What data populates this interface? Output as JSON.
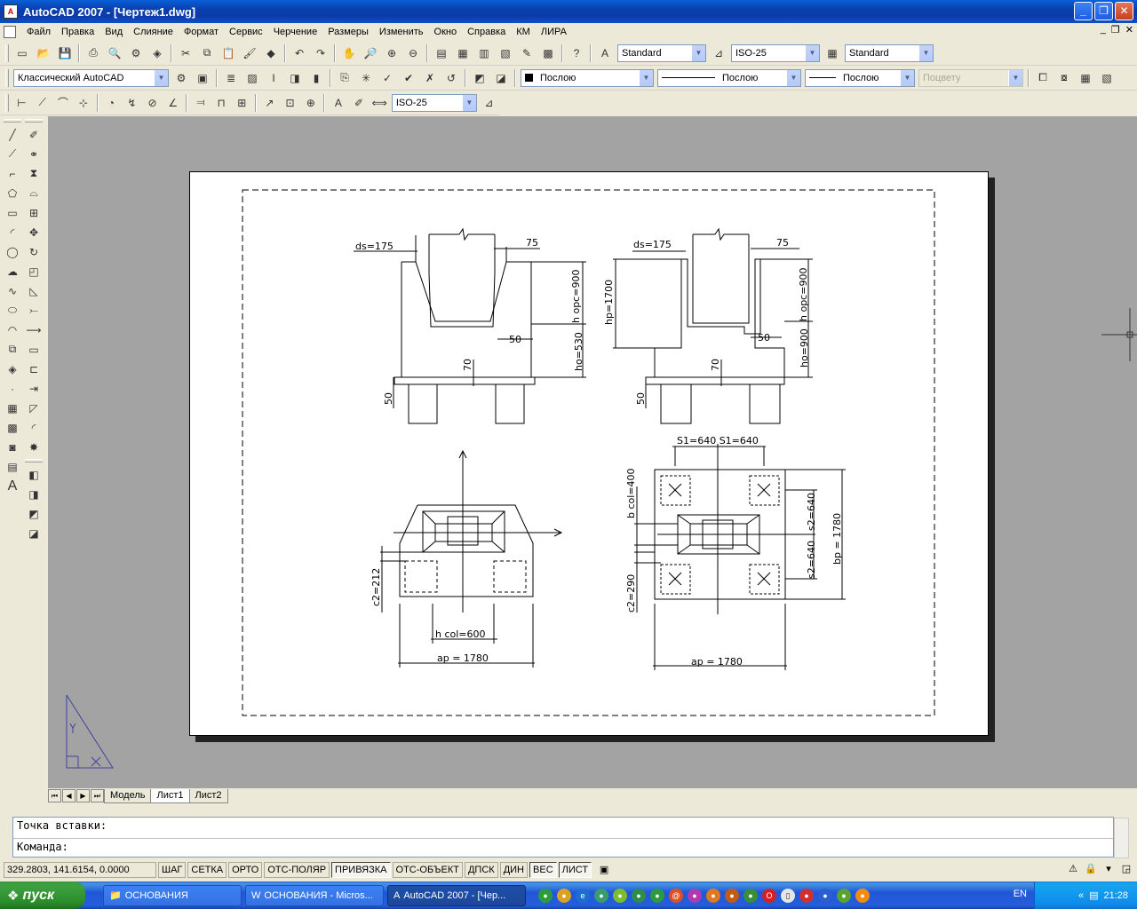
{
  "window": {
    "title": "AutoCAD 2007 - [Чертеж1.dwg]",
    "controls": {
      "minimize": "_",
      "maximize": "❐",
      "close": "✕"
    }
  },
  "menu": {
    "items": [
      "Файл",
      "Правка",
      "Вид",
      "Слияние",
      "Формат",
      "Сервис",
      "Черчение",
      "Размеры",
      "Изменить",
      "Окно",
      "Справка",
      "КМ",
      "ЛИРА"
    ],
    "mdi_controls": [
      "_",
      "❐",
      "✕"
    ]
  },
  "toolbar1": {
    "text_style": "Standard",
    "dim_style": "ISO-25",
    "table_style": "Standard"
  },
  "toolbar2": {
    "workspace": "Классический AutoCAD",
    "layer_color": "Послою",
    "linetype": "Послою",
    "lineweight": "Послою",
    "plot_style": "Поцвету"
  },
  "toolbar3": {
    "dim_style": "ISO-25"
  },
  "drawing": {
    "top_left": {
      "ds": "ds=175",
      "d75": "75",
      "hopc": "h opc=900",
      "d50": "50",
      "ho": "ho=530",
      "d70": "70",
      "d50b": "50"
    },
    "top_right": {
      "ds": "ds=175",
      "d75": "75",
      "hopc": "h opc=900",
      "hp": "hp=1700",
      "d50": "50",
      "ho": "ho=900",
      "d70": "70",
      "d50b": "50"
    },
    "bottom_left": {
      "c2": "c2=212",
      "hcol": "h col=600",
      "ap": "ap = 1780"
    },
    "bottom_right": {
      "s1": "S1=640  S1=640",
      "bcol": "b col=400",
      "s2a": "s2=640",
      "s2b": "s2=640",
      "bp": "bp = 1780",
      "c2": "c2=290",
      "ap": "ap = 1780"
    }
  },
  "layout_tabs": [
    "Модель",
    "Лист1",
    "Лист2"
  ],
  "active_tab": "Лист1",
  "command": {
    "history": "Точка вставки:",
    "prompt": "Команда:"
  },
  "status": {
    "coords": "329.2803, 141.6154, 0.0000",
    "buttons": [
      "ШАГ",
      "СЕТКА",
      "ОРТО",
      "ОТС-ПОЛЯР",
      "ПРИВЯЗКА",
      "ОТС-ОБЪЕКТ",
      "ДПСК",
      "ДИН",
      "ВЕС",
      "ЛИСТ"
    ],
    "on_buttons": [
      "ПРИВЯЗКА",
      "ВЕС",
      "ЛИСТ"
    ]
  },
  "taskbar": {
    "start": "пуск",
    "tasks": [
      "ОСНОВАНИЯ",
      "ОСНОВАНИЯ - Micros...",
      "AutoCAD 2007 - [Чер..."
    ],
    "lang": "EN",
    "clock": "21:28"
  }
}
